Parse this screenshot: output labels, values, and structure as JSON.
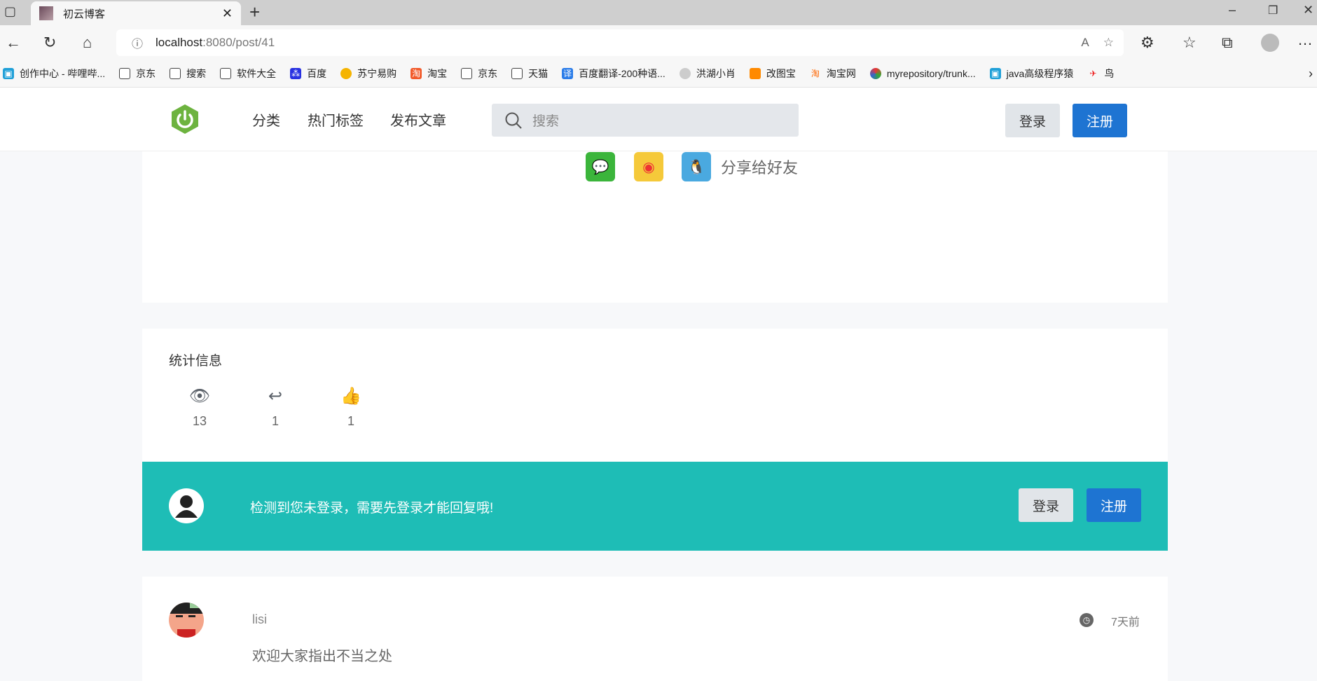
{
  "browser": {
    "tab_title": "初云博客",
    "url_host": "localhost",
    "url_path": ":8080/post/41",
    "bookmarks": [
      "创作中心 - 哔哩哔...",
      "京东",
      "搜索",
      "软件大全",
      "百度",
      "苏宁易购",
      "淘宝",
      "京东",
      "天猫",
      "百度翻译-200种语...",
      "洪湖小肖",
      "改图宝",
      "淘宝网",
      "myrepository/trunk...",
      "java高级程序猿",
      "鸟"
    ]
  },
  "header": {
    "nav": [
      "分类",
      "热门标签",
      "发布文章"
    ],
    "search_placeholder": "搜索",
    "login": "登录",
    "register": "注册"
  },
  "share": {
    "label": "分享给好友"
  },
  "stats": {
    "title": "统计信息",
    "views": "13",
    "replies": "1",
    "likes": "1"
  },
  "banner": {
    "message": "检测到您未登录，需要先登录才能回复哦!",
    "login": "登录",
    "register": "注册"
  },
  "comment": {
    "author": "lisi",
    "time": "7天前",
    "content": "欢迎大家指出不当之处"
  },
  "colors": {
    "accent": "#1e74d2",
    "banner": "#1ebdb6",
    "logo": "#6db33f"
  }
}
